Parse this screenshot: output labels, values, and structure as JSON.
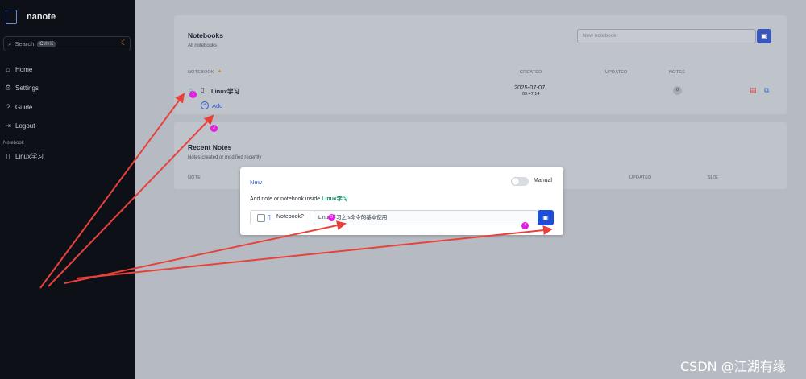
{
  "app": {
    "name": "nanote"
  },
  "sidebar": {
    "search": {
      "label": "Search",
      "shortcut": "Ctrl+K"
    },
    "nav": [
      {
        "label": "Home",
        "icon": "home-icon"
      },
      {
        "label": "Settings",
        "icon": "gear-icon"
      },
      {
        "label": "Guide",
        "icon": "help-circle-icon"
      },
      {
        "label": "Logout",
        "icon": "logout-icon"
      }
    ],
    "section_label": "Notebook",
    "notebooks": [
      {
        "label": "Linux学习",
        "icon": "notebook-icon"
      }
    ]
  },
  "notebooks_card": {
    "title": "Notebooks",
    "subtitle": "All notebooks",
    "new_placeholder": "New notebook",
    "columns": {
      "notebook": "NOTEBOOK",
      "created": "CREATED",
      "updated": "UPDATED",
      "notes": "NOTES"
    },
    "rows": [
      {
        "name": "Linux学习",
        "created_date": "2025-07-07",
        "created_time": "09:47:14",
        "notes": "0"
      }
    ],
    "add_label": "Add"
  },
  "recent_card": {
    "title": "Recent Notes",
    "subtitle": "Notes created or modified recently",
    "columns": {
      "note": "NOTE",
      "updated": "UPDATED",
      "size": "SIZE"
    }
  },
  "modal": {
    "new_label": "New",
    "manual_label": "Manual",
    "hint_prefix": "Add note or notebook inside ",
    "hint_target": "Linux学习",
    "notebook_label": "Notebook?",
    "input_value": "Linux学习之ls命令的基本使用"
  },
  "markers": [
    "1",
    "2",
    "3",
    "4"
  ],
  "watermark": "CSDN @江湖有缘",
  "colors": {
    "accent": "#1d4ed8",
    "sidebar_bg": "#0d1117",
    "arrow": "#e8413c",
    "marker": "#e11ee0",
    "green": "#0d8a5b"
  }
}
